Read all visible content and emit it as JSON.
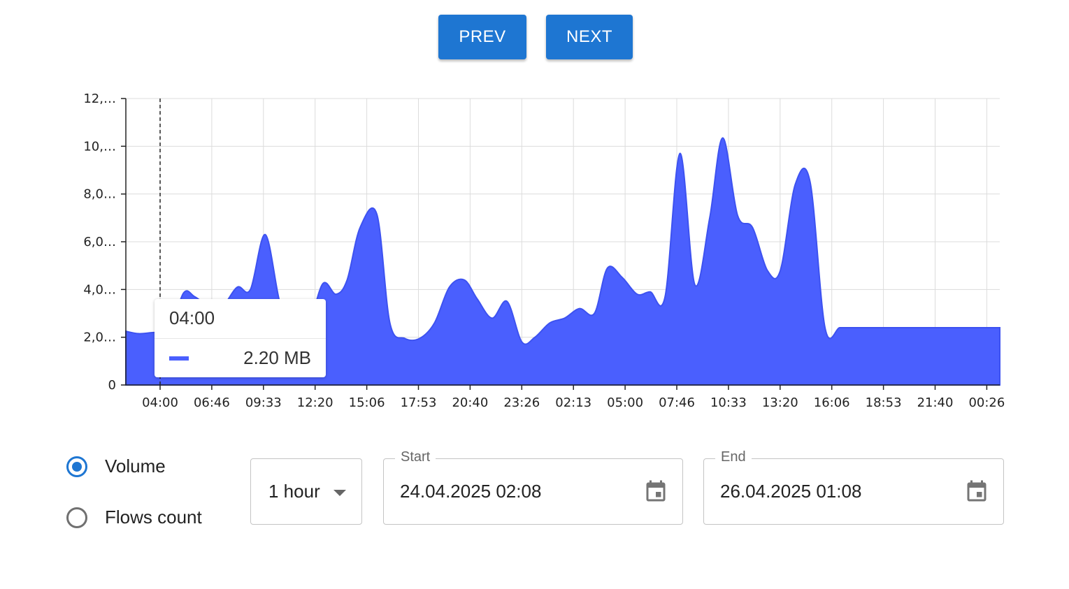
{
  "nav": {
    "prev_label": "PREV",
    "next_label": "NEXT",
    "accent_color": "#1e76d2"
  },
  "chart_data": {
    "type": "area",
    "color": "#4a5ffe",
    "y_tick_labels": [
      "0",
      "2,0…",
      "4,0…",
      "6,0…",
      "8,0…",
      "10,…",
      "12,…"
    ],
    "ylim": [
      0,
      12
    ],
    "x_tick_labels": [
      "04:00",
      "06:46",
      "09:33",
      "12:20",
      "15:06",
      "17:53",
      "20:40",
      "23:26",
      "02:13",
      "05:00",
      "07:46",
      "10:33",
      "13:20",
      "16:06",
      "18:53",
      "21:40",
      "00:26"
    ],
    "grid": true,
    "x_hours_from_start": [
      0,
      0.7,
      1.5,
      2.3,
      3.1,
      3.7,
      4.5,
      5.2,
      6.0,
      6.7,
      7.5,
      8.3,
      9.0,
      9.8,
      10.6,
      11.3,
      11.9,
      12.6,
      13.5,
      14.2,
      15.0,
      15.8,
      16.6,
      17.4,
      18.2,
      18.9,
      19.7,
      20.5,
      21.3,
      22.0,
      22.8,
      23.6,
      24.4,
      25.2,
      25.9,
      26.7,
      27.5,
      28.2,
      29.0,
      29.8,
      30.6,
      31.4,
      32.1,
      32.9,
      33.7,
      34.5,
      35.2,
      36.0,
      36.8,
      37.6,
      38.4,
      39.1,
      39.9,
      40.7,
      41.5,
      42.3,
      43.0,
      43.8,
      44.6,
      45.4,
      46.1,
      47.0
    ],
    "values": [
      2.25,
      2.15,
      2.2,
      2.2,
      3.85,
      3.7,
      3.3,
      3.3,
      4.1,
      4.0,
      6.3,
      3.4,
      2.6,
      2.5,
      4.25,
      3.8,
      4.4,
      6.6,
      7.15,
      2.6,
      1.95,
      1.95,
      2.6,
      4.1,
      4.4,
      3.6,
      2.8,
      3.5,
      1.8,
      2.0,
      2.6,
      2.8,
      3.2,
      3.0,
      4.9,
      4.5,
      3.8,
      3.9,
      3.7,
      9.7,
      4.2,
      7.0,
      10.35,
      7.1,
      6.6,
      4.8,
      4.8,
      8.4,
      8.5,
      2.4,
      2.4,
      2.4,
      2.4,
      2.4,
      2.4,
      2.4,
      2.4,
      2.4,
      2.4,
      2.4,
      2.4,
      2.4
    ],
    "hover": {
      "time": "04:00",
      "value_label": "2.20 MB"
    }
  },
  "metric": {
    "options": [
      {
        "label": "Volume",
        "checked": true
      },
      {
        "label": "Flows count",
        "checked": false
      }
    ]
  },
  "interval": {
    "value": "1 hour"
  },
  "start": {
    "legend": "Start",
    "value": "24.04.2025 02:08"
  },
  "end": {
    "legend": "End",
    "value": "26.04.2025 01:08"
  }
}
